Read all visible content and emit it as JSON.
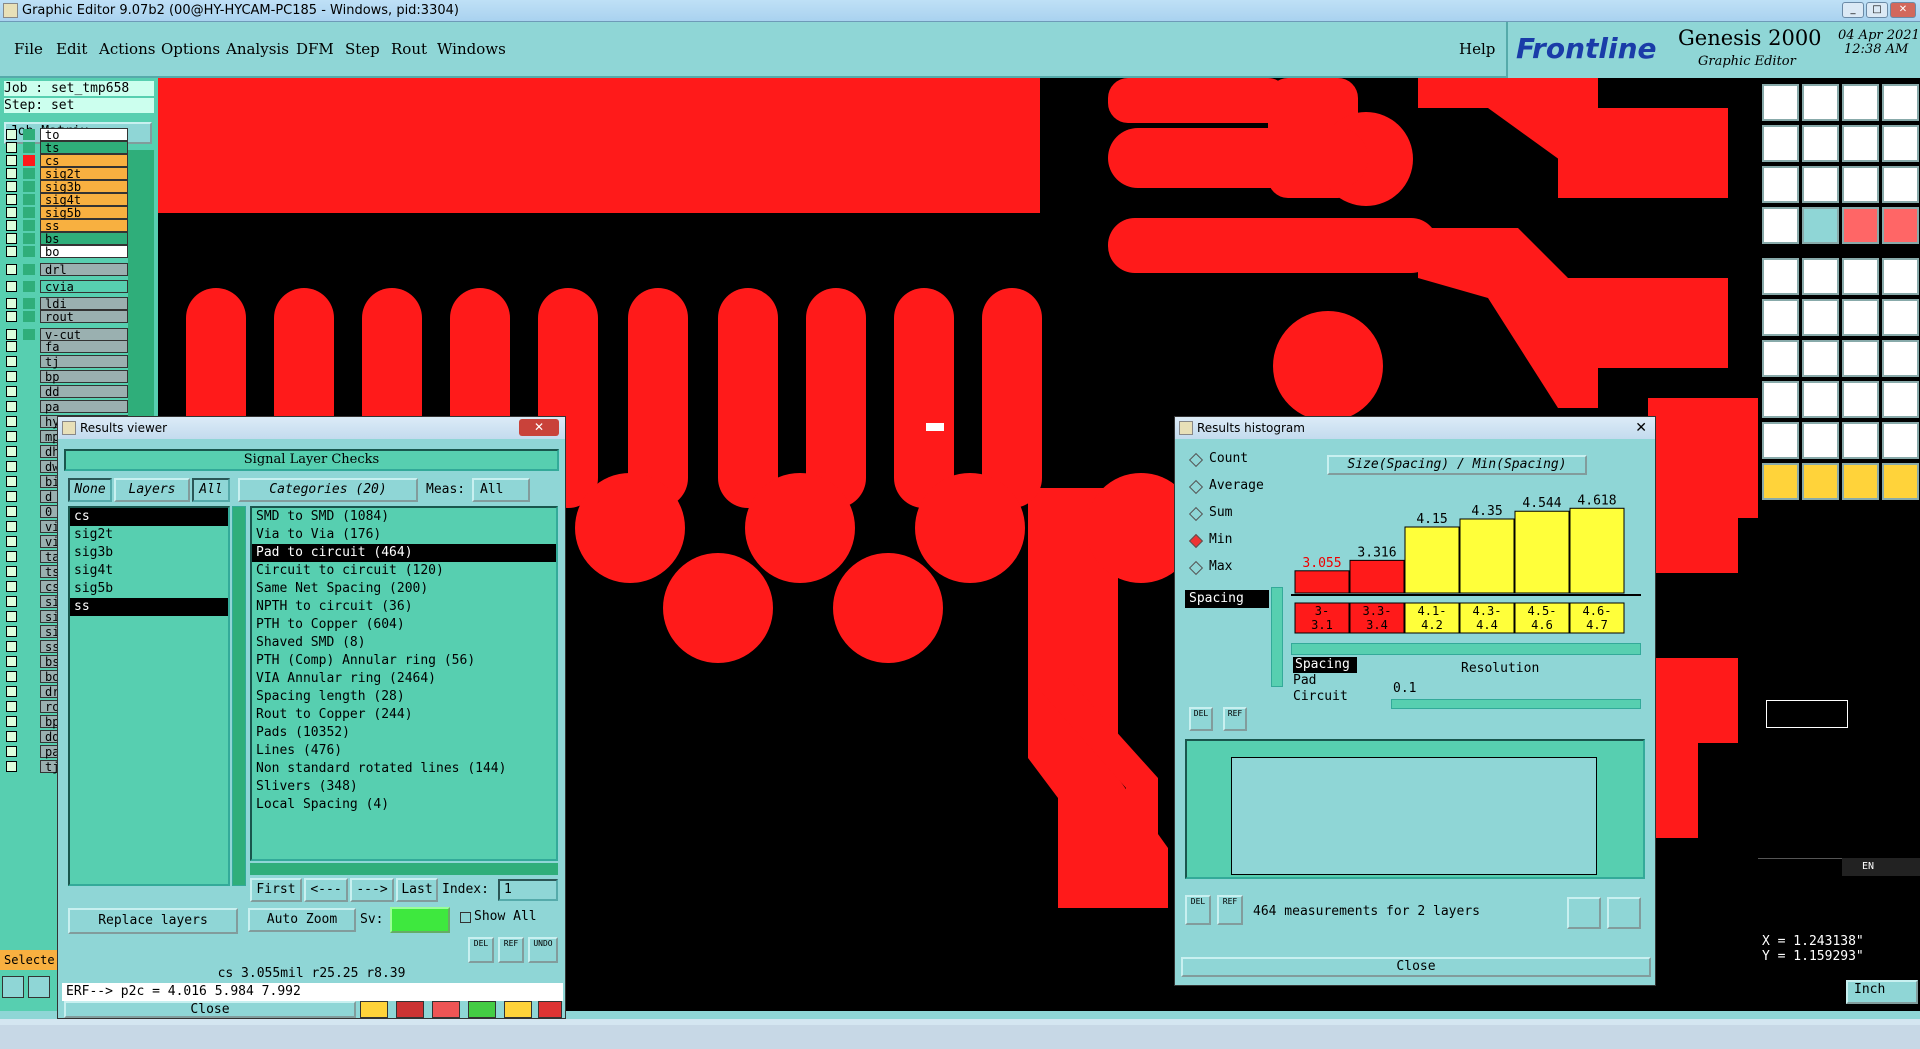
{
  "window": {
    "title": "Graphic Editor 9.07b2 (00@HY-HYCAM-PC185 - Windows, pid:3304)"
  },
  "menu": {
    "items": [
      "File",
      "Edit",
      "Actions",
      "Options",
      "Analysis",
      "DFM",
      "Step",
      "Rout",
      "Windows"
    ],
    "help": "Help"
  },
  "brand": {
    "logo": "Frontline",
    "product": "Genesis 2000",
    "subtitle": "Graphic Editor",
    "date": "04 Apr 2021",
    "time": "12:38 AM"
  },
  "job": {
    "job_label": "Job : set_tmp658",
    "step_label": "Step: set",
    "matrix_button": "Job Matrix ..."
  },
  "layers": [
    {
      "name": "to",
      "color": "#ffffff"
    },
    {
      "name": "ts",
      "color": "#2fae7a"
    },
    {
      "name": "cs",
      "color": "#f8b040",
      "active": true
    },
    {
      "name": "sig2t",
      "color": "#f8b040"
    },
    {
      "name": "sig3b",
      "color": "#f8b040"
    },
    {
      "name": "sig4t",
      "color": "#f8b040"
    },
    {
      "name": "sig5b",
      "color": "#f8b040"
    },
    {
      "name": "ss",
      "color": "#f8b040"
    },
    {
      "name": "bs",
      "color": "#2fae7a"
    },
    {
      "name": "bo",
      "color": "#ffffff"
    },
    {
      "name": "drl",
      "color": "#9ab0b0"
    },
    {
      "name": "cvia",
      "color": "#57cfb0"
    },
    {
      "name": "ldi",
      "color": "#9ab0b0"
    },
    {
      "name": "rout",
      "color": "#9ab0b0"
    },
    {
      "name": "v-cut",
      "color": "#9ab0b0"
    }
  ],
  "layers_hidden_partial": [
    "fa",
    "tj",
    "bp",
    "dd",
    "pa",
    "hy",
    "mp",
    "dh",
    "dw",
    "bi",
    "d",
    "0",
    "vi",
    "vi",
    "ta",
    "ts",
    "cs",
    "si",
    "si",
    "si",
    "ss",
    "bs",
    "bo",
    "dr",
    "ro",
    "bp",
    "dd",
    "pa",
    "tj"
  ],
  "left_status": "Selecte",
  "results_viewer": {
    "title": "Results viewer",
    "header": "Signal Layer Checks",
    "none": "None",
    "layers_btn": "Layers",
    "all_btn": "All",
    "categories_btn": "Categories (20)",
    "meas_label": "Meas:",
    "meas_value": "All",
    "layer_list": [
      "cs",
      "sig2t",
      "sig3b",
      "sig4t",
      "sig5b",
      "ss"
    ],
    "category_list": [
      "SMD to SMD (1084)",
      "Via to Via (176)",
      "Pad to circuit (464)",
      "Circuit to circuit (120)",
      "Same Net Spacing (200)",
      "NPTH to circuit (36)",
      "PTH to Copper (604)",
      "Shaved SMD (8)",
      "PTH (Comp) Annular ring (56)",
      "VIA Annular ring (2464)",
      "Spacing length (28)",
      "Rout to Copper (244)",
      "Pads (10352)",
      "Lines (476)",
      "Non standard rotated lines (144)",
      "Slivers (348)",
      "Local Spacing (4)"
    ],
    "first": "First",
    "prev": "<---",
    "next": "--->",
    "last": "Last",
    "index_label": "Index:",
    "index_value": "1",
    "auto_zoom": "Auto Zoom",
    "sv_label": "Sv:",
    "show_all": "Show All",
    "replace_layers": "Replace layers",
    "del": "DEL",
    "ref": "REF",
    "undo": "UNDO",
    "info_line": "cs 3.055mil  r25.25  r8.39",
    "erf_line": "ERF--> p2c = 4.016 5.984 7.992",
    "close": "Close"
  },
  "histogram": {
    "title": "Results histogram",
    "modes": [
      "Count",
      "Average",
      "Sum",
      "Min",
      "Max"
    ],
    "selected_mode": "Min",
    "measure_list": [
      "Spacing"
    ],
    "chart_title": "Size(Spacing) / Min(Spacing)",
    "sub_list": [
      "Spacing",
      "Pad",
      "Circuit"
    ],
    "resolution_label": "Resolution",
    "resolution_value": "0.1",
    "del": "DEL",
    "ref": "REF",
    "summary": "464 measurements for 2 layers",
    "close": "Close"
  },
  "chart_data": {
    "type": "bar",
    "title": "Size(Spacing) / Min(Spacing)",
    "categories": [
      "3-3.1",
      "3.3-3.4",
      "4.1-4.2",
      "4.3-4.4",
      "4.5-4.6",
      "4.6-4.7"
    ],
    "category_labels": [
      [
        "3-",
        "3.1"
      ],
      [
        "3.3-",
        "3.4"
      ],
      [
        "4.1-",
        "4.2"
      ],
      [
        "4.3-",
        "4.4"
      ],
      [
        "4.5-",
        "4.6"
      ],
      [
        "4.6-",
        "4.7"
      ]
    ],
    "values": [
      3.055,
      3.316,
      4.15,
      4.35,
      4.544,
      4.618
    ],
    "value_labels": [
      "3.055",
      "3.316",
      "4.15",
      "4.35",
      "4.544",
      "4.618"
    ],
    "colors": [
      "#ff1a1a",
      "#ff1a1a",
      "#ffff3a",
      "#ffff3a",
      "#ffff3a",
      "#ffff3a"
    ],
    "ylim": [
      2.5,
      4.7
    ]
  },
  "coords": {
    "x": "X = 1.243138\"",
    "y": "Y = 1.159293\""
  },
  "units": "Inch",
  "ime": {
    "lang": "EN"
  }
}
